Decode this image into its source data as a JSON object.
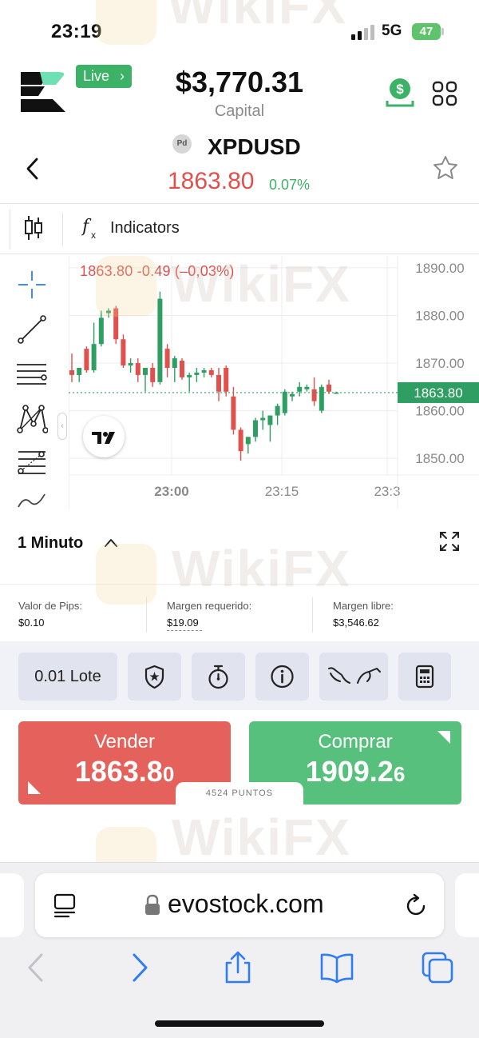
{
  "status_bar": {
    "time": "23:19",
    "network": "5G",
    "battery": "47"
  },
  "header": {
    "live_label": "Live",
    "capital_value": "$3,770.31",
    "capital_label": "Capital"
  },
  "instrument": {
    "badge": "Pd",
    "symbol": "XPDUSD",
    "price": "1863.80",
    "change": "0.07%"
  },
  "chart_toolbar": {
    "indicators_label": "Indicators"
  },
  "chart_data": {
    "type": "candlestick",
    "info": "1863.80  -0.49 (–0,03%)",
    "y_ticks": [
      "1890.00",
      "1880.00",
      "1870.00",
      "1860.00",
      "1850.00"
    ],
    "x_ticks": [
      "23:00",
      "23:15",
      "23:3"
    ],
    "ylim": [
      1846.5,
      1892.5
    ],
    "current_price": "1863.80",
    "up_color": "#2e9e62",
    "down_color": "#e0504d",
    "candles": [
      {
        "o": 1868.5,
        "h": 1872.0,
        "l": 1866.0,
        "c": 1867.5
      },
      {
        "o": 1867.5,
        "h": 1869.0,
        "l": 1866.0,
        "c": 1869.0
      },
      {
        "o": 1873.0,
        "h": 1873.5,
        "l": 1868.0,
        "c": 1868.5
      },
      {
        "o": 1868.5,
        "h": 1878.5,
        "l": 1868.0,
        "c": 1874.0
      },
      {
        "o": 1874.0,
        "h": 1881.0,
        "l": 1873.5,
        "c": 1879.5
      },
      {
        "o": 1880.5,
        "h": 1881.5,
        "l": 1879.5,
        "c": 1881.0
      },
      {
        "o": 1881.5,
        "h": 1882.0,
        "l": 1874.0,
        "c": 1875.0
      },
      {
        "o": 1875.0,
        "h": 1876.0,
        "l": 1869.0,
        "c": 1869.5
      },
      {
        "o": 1869.5,
        "h": 1871.0,
        "l": 1868.0,
        "c": 1870.0
      },
      {
        "o": 1870.0,
        "h": 1871.0,
        "l": 1866.0,
        "c": 1867.5
      },
      {
        "o": 1867.5,
        "h": 1868.0,
        "l": 1864.0,
        "c": 1869.0
      },
      {
        "o": 1869.0,
        "h": 1870.0,
        "l": 1865.0,
        "c": 1866.0
      },
      {
        "o": 1866.0,
        "h": 1885.0,
        "l": 1865.5,
        "c": 1883.5
      },
      {
        "o": 1873.0,
        "h": 1874.0,
        "l": 1867.0,
        "c": 1869.0
      },
      {
        "o": 1869.0,
        "h": 1871.5,
        "l": 1866.0,
        "c": 1871.0
      },
      {
        "o": 1870.5,
        "h": 1871.0,
        "l": 1866.5,
        "c": 1867.0
      },
      {
        "o": 1867.0,
        "h": 1868.0,
        "l": 1864.0,
        "c": 1867.5
      },
      {
        "o": 1867.5,
        "h": 1869.0,
        "l": 1866.0,
        "c": 1868.0
      },
      {
        "o": 1868.0,
        "h": 1869.0,
        "l": 1867.0,
        "c": 1868.5
      },
      {
        "o": 1868.5,
        "h": 1869.0,
        "l": 1867.0,
        "c": 1867.5
      },
      {
        "o": 1867.5,
        "h": 1869.0,
        "l": 1862.0,
        "c": 1864.0
      },
      {
        "o": 1869.0,
        "h": 1869.5,
        "l": 1863.0,
        "c": 1864.0
      },
      {
        "o": 1863.0,
        "h": 1865.0,
        "l": 1855.0,
        "c": 1856.0
      },
      {
        "o": 1856.0,
        "h": 1856.5,
        "l": 1849.5,
        "c": 1851.5
      },
      {
        "o": 1853.0,
        "h": 1854.5,
        "l": 1851.0,
        "c": 1854.5
      },
      {
        "o": 1854.5,
        "h": 1858.5,
        "l": 1853.5,
        "c": 1858.0
      },
      {
        "o": 1858.0,
        "h": 1860.0,
        "l": 1856.0,
        "c": 1858.5
      },
      {
        "o": 1857.0,
        "h": 1859.0,
        "l": 1853.5,
        "c": 1859.0
      },
      {
        "o": 1859.0,
        "h": 1861.5,
        "l": 1857.0,
        "c": 1861.0
      },
      {
        "o": 1859.5,
        "h": 1864.5,
        "l": 1859.0,
        "c": 1864.0
      },
      {
        "o": 1863.0,
        "h": 1864.0,
        "l": 1862.0,
        "c": 1863.5
      },
      {
        "o": 1864.0,
        "h": 1866.0,
        "l": 1863.0,
        "c": 1865.0
      },
      {
        "o": 1864.5,
        "h": 1865.5,
        "l": 1864.0,
        "c": 1865.0
      },
      {
        "o": 1864.5,
        "h": 1867.0,
        "l": 1861.0,
        "c": 1862.0
      },
      {
        "o": 1860.0,
        "h": 1865.5,
        "l": 1859.5,
        "c": 1865.0
      },
      {
        "o": 1865.5,
        "h": 1866.5,
        "l": 1863.5,
        "c": 1864.0
      },
      {
        "o": 1863.8,
        "h": 1864.0,
        "l": 1863.6,
        "c": 1863.8
      }
    ]
  },
  "timeframe": {
    "label": "1 Minuto"
  },
  "margin_info": [
    {
      "label": "Valor de Pips:",
      "value": "$0.10"
    },
    {
      "label": "Margen requerido:",
      "value": "$19.09"
    },
    {
      "label": "Margen libre:",
      "value": "$3,546.62"
    }
  ],
  "options": {
    "lot_label": "0.01 Lote"
  },
  "trade": {
    "sell_label": "Vender",
    "sell_price_main": "1863.8",
    "sell_price_small": "0",
    "buy_label": "Comprar",
    "buy_price_main": "1909.2",
    "buy_price_small": "6",
    "spread_label": "4524 PUNTOS"
  },
  "browser": {
    "url": "evostock.com"
  },
  "watermark": {
    "text": "WikiFX"
  },
  "colors": {
    "accent_green": "#3bb265",
    "sell_red": "#e4625b",
    "buy_green": "#58c07d",
    "ios_blue": "#2f7cf6"
  }
}
